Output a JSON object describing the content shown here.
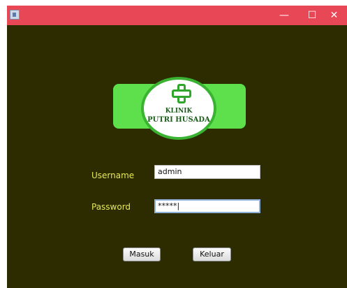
{
  "window": {
    "controls": {
      "minimize": "—",
      "maximize": "☐",
      "close": "✕"
    },
    "colors": {
      "titlebar": "#e84856",
      "background": "#2c2c00",
      "label": "#e8e85a",
      "logo_green": "#5ee04c"
    }
  },
  "logo": {
    "line1": "KLINIK",
    "line2": "PUTRI HUSADA",
    "icon": "medical-cross-icon"
  },
  "form": {
    "username_label": "Username",
    "username_value": "admin",
    "password_label": "Password",
    "password_value": "*****|"
  },
  "buttons": {
    "masuk": "Masuk",
    "keluar": "Keluar"
  }
}
